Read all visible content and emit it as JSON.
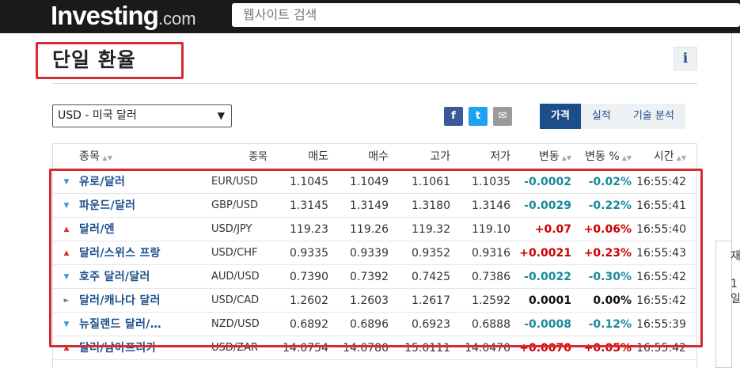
{
  "header": {
    "logo_main": "Investing",
    "logo_suffix": ".com",
    "search_placeholder": "웹사이트 검색"
  },
  "page": {
    "title": "단일 환율",
    "info_label": "i"
  },
  "currency_select": {
    "value": "USD - 미국 달러"
  },
  "share": {
    "facebook": "f",
    "twitter": "t",
    "mail": "✉"
  },
  "tabs": [
    {
      "label": "가격",
      "active": true
    },
    {
      "label": "실적",
      "active": false
    },
    {
      "label": "기술 분석",
      "active": false
    }
  ],
  "table": {
    "headers": {
      "name": "종목",
      "symbol": "종목",
      "bid": "매도",
      "ask": "매수",
      "high": "고가",
      "low": "저가",
      "change": "변동",
      "change_pct": "변동 %",
      "time": "시간"
    },
    "rows": [
      {
        "dir": "down",
        "name": "유로/달러",
        "symbol": "EUR/USD",
        "bid": "1.1045",
        "ask": "1.1049",
        "high": "1.1061",
        "low": "1.1035",
        "change": "-0.0002",
        "change_pct": "-0.02%",
        "time": "16:55:42"
      },
      {
        "dir": "down",
        "name": "파운드/달러",
        "symbol": "GBP/USD",
        "bid": "1.3145",
        "ask": "1.3149",
        "high": "1.3180",
        "low": "1.3146",
        "change": "-0.0029",
        "change_pct": "-0.22%",
        "time": "16:55:41"
      },
      {
        "dir": "up",
        "name": "달러/엔",
        "symbol": "USD/JPY",
        "bid": "119.23",
        "ask": "119.26",
        "high": "119.32",
        "low": "119.10",
        "change": "+0.07",
        "change_pct": "+0.06%",
        "time": "16:55:40"
      },
      {
        "dir": "up",
        "name": "달러/스위스 프랑",
        "symbol": "USD/CHF",
        "bid": "0.9335",
        "ask": "0.9339",
        "high": "0.9352",
        "low": "0.9316",
        "change": "+0.0021",
        "change_pct": "+0.23%",
        "time": "16:55:43"
      },
      {
        "dir": "down",
        "name": "호주 달러/달러",
        "symbol": "AUD/USD",
        "bid": "0.7390",
        "ask": "0.7392",
        "high": "0.7425",
        "low": "0.7386",
        "change": "-0.0022",
        "change_pct": "-0.30%",
        "time": "16:55:42"
      },
      {
        "dir": "flat",
        "name": "달러/캐나다 달러",
        "symbol": "USD/CAD",
        "bid": "1.2602",
        "ask": "1.2603",
        "high": "1.2617",
        "low": "1.2592",
        "change": "0.0001",
        "change_pct": "0.00%",
        "time": "16:55:42"
      },
      {
        "dir": "down",
        "name": "뉴질랜드 달러/…",
        "symbol": "NZD/USD",
        "bid": "0.6892",
        "ask": "0.6896",
        "high": "0.6923",
        "low": "0.6888",
        "change": "-0.0008",
        "change_pct": "-0.12%",
        "time": "16:55:39"
      },
      {
        "dir": "up",
        "name": "달러/남아프리카",
        "symbol": "USD/ZAR",
        "bid": "14.0754",
        "ask": "14.0780",
        "high": "15.0111",
        "low": "14.0470",
        "change": "+0.0070",
        "change_pct": "+0.05%",
        "time": "16:55:42"
      }
    ]
  },
  "side_panel": {
    "line1": "재",
    "line2": "1",
    "line3": "일"
  },
  "colors": {
    "accent": "#1c4f8a",
    "positive": "#cc0000",
    "negative": "#1a8a9a",
    "highlight": "#d52b32",
    "topbar": "#1a1a1a"
  }
}
